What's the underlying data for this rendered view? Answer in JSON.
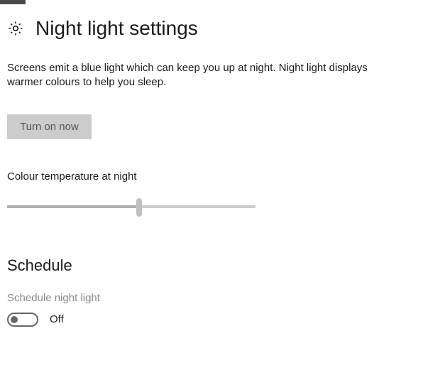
{
  "header": {
    "title": "Night light settings"
  },
  "main": {
    "description": "Screens emit a blue light which can keep you up at night. Night light displays warmer colours to help you sleep.",
    "turn_on_label": "Turn on now",
    "temperature_label": "Colour temperature at night",
    "slider_percent": 53
  },
  "schedule": {
    "heading": "Schedule",
    "toggle_label": "Schedule night light",
    "toggle_state": "Off",
    "toggle_on": false
  }
}
